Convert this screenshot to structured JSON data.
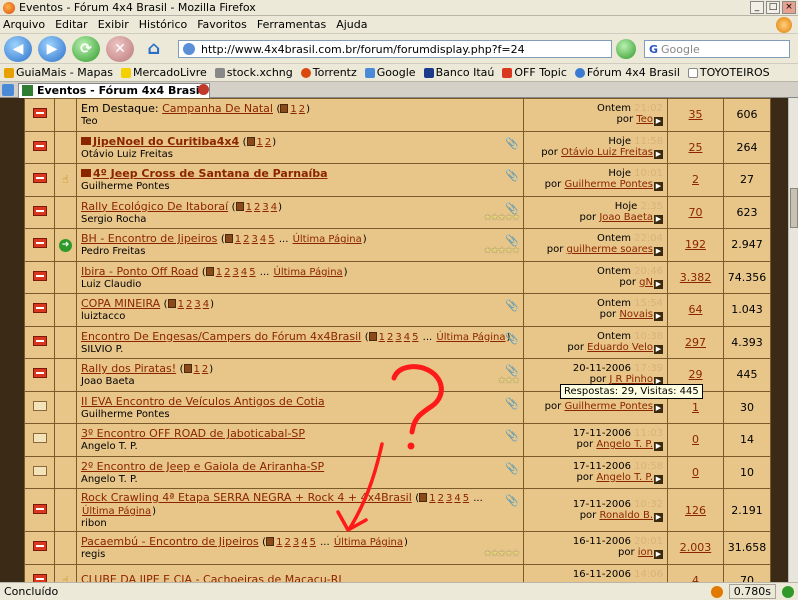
{
  "window": {
    "title": "Eventos - Fórum 4x4 Brasil - Mozilla Firefox",
    "min": "_",
    "max": "□",
    "close": "×"
  },
  "menu": [
    "Arquivo",
    "Editar",
    "Exibir",
    "Histórico",
    "Favoritos",
    "Ferramentas",
    "Ajuda"
  ],
  "nav": {
    "url": "http://www.4x4brasil.com.br/forum/forumdisplay.php?f=24",
    "search_placeholder": "Google",
    "search_brand": "G"
  },
  "bookmarks": [
    "GuiaMais - Mapas",
    "MercadoLivre",
    "stock.xchng",
    "Torrentz",
    "Google",
    "Banco Itaú",
    "OFF Topic",
    "Fórum 4x4 Brasil",
    "TOYOTEIROS"
  ],
  "tab": {
    "label": "Eventos - Fórum 4x4 Brasil"
  },
  "threads": [
    {
      "status": "hot",
      "icon": "",
      "prefix": "Em Destaque: ",
      "title": "Campanha De Natal",
      "bold": false,
      "sticky": false,
      "pages": [
        "1",
        "2"
      ],
      "last_page": "",
      "author": "Teo",
      "date": "Ontem",
      "time": "21:02",
      "by_label": "por",
      "by": "Teo",
      "replies": "35",
      "views": "606",
      "clip": "",
      "stars": ""
    },
    {
      "status": "hot-lock",
      "icon": "",
      "prefix": "",
      "title": "JipeNoel do Curitiba4x4",
      "bold": true,
      "sticky": true,
      "pages": [
        "1",
        "2"
      ],
      "last_page": "",
      "author": "Otávio Luiz Freitas",
      "date": "Hoje",
      "time": "11:58",
      "by_label": "por",
      "by": "Otávio Luiz Freitas",
      "replies": "25",
      "views": "264",
      "clip": "📎",
      "stars": ""
    },
    {
      "status": "hot-lock",
      "icon": "flag",
      "prefix": "",
      "title": "4º Jeep Cross de Santana de Parnaíba",
      "bold": true,
      "sticky": true,
      "pages": [],
      "last_page": "",
      "author": "Guilherme Pontes",
      "date": "Hoje",
      "time": "10:01",
      "by_label": "por",
      "by": "Guilherme Pontes",
      "replies": "2",
      "views": "27",
      "clip": "📎",
      "stars": ""
    },
    {
      "status": "hot",
      "icon": "",
      "prefix": "",
      "title": "Rally Ecológico De Itaboraí",
      "bold": false,
      "sticky": false,
      "pages": [
        "1",
        "2",
        "3",
        "4"
      ],
      "last_page": "",
      "author": "Sergio Rocha",
      "date": "Hoje",
      "time": "2:35",
      "by_label": "por",
      "by": "Joao Baeta",
      "replies": "70",
      "views": "623",
      "clip": "📎",
      "stars": "★★★★★"
    },
    {
      "status": "hot",
      "icon": "arrow",
      "prefix": "",
      "title": "BH - Encontro de Jipeiros",
      "bold": false,
      "sticky": false,
      "pages": [
        "1",
        "2",
        "3",
        "4",
        "5"
      ],
      "last_page": "Última Página",
      "author": "Pedro Freitas",
      "date": "Ontem",
      "time": "22:04",
      "by_label": "por",
      "by": "guilherme soares",
      "replies": "192",
      "views": "2.947",
      "clip": "📎",
      "stars": "★★★★★"
    },
    {
      "status": "hot",
      "icon": "",
      "prefix": "",
      "title": "Ibira - Ponto Off Road",
      "bold": false,
      "sticky": false,
      "pages": [
        "1",
        "2",
        "3",
        "4",
        "5"
      ],
      "last_page": "Última Página",
      "author": "Luiz Claudio",
      "date": "Ontem",
      "time": "20:46",
      "by_label": "por",
      "by": "gN",
      "replies": "3.382",
      "views": "74.356",
      "clip": "",
      "stars": ""
    },
    {
      "status": "hot",
      "icon": "",
      "prefix": "",
      "title": "COPA MINEIRA",
      "bold": false,
      "sticky": false,
      "pages": [
        "1",
        "2",
        "3",
        "4"
      ],
      "last_page": "",
      "author": "luiztacco",
      "date": "Ontem",
      "time": "15:54",
      "by_label": "por",
      "by": "Novais",
      "replies": "64",
      "views": "1.043",
      "clip": "📎",
      "stars": ""
    },
    {
      "status": "hot",
      "icon": "",
      "prefix": "",
      "title": "Encontro De Engesas/Campers do Fórum 4x4Brasil",
      "bold": false,
      "sticky": false,
      "pages": [
        "1",
        "2",
        "3",
        "4",
        "5"
      ],
      "last_page": "Última Página",
      "author": "SILVIO P.",
      "date": "Ontem",
      "time": "10:38",
      "by_label": "por",
      "by": "Eduardo Velo",
      "replies": "297",
      "views": "4.393",
      "clip": "📎",
      "stars": ""
    },
    {
      "status": "hot",
      "icon": "",
      "prefix": "",
      "title": "Rally dos Piratas!",
      "bold": false,
      "sticky": false,
      "pages": [
        "1",
        "2"
      ],
      "last_page": "",
      "author": "Joao Baeta",
      "date": "20-11-2006",
      "time": "17:39",
      "by_label": "por",
      "by": "J R Pinho",
      "replies": "29",
      "views": "445",
      "clip": "📎",
      "stars": "★★★"
    },
    {
      "status": "read",
      "icon": "",
      "prefix": "",
      "title": "II EVA Encontro de Veículos Antigos de Cotia",
      "bold": false,
      "sticky": false,
      "pages": [],
      "last_page": "",
      "author": "Guilherme Pontes",
      "date": "",
      "time": "",
      "by_label": "por",
      "by": "Guilherme Pontes",
      "replies": "1",
      "views": "30",
      "clip": "📎",
      "stars": ""
    },
    {
      "status": "read",
      "icon": "",
      "prefix": "",
      "title": "3º Encontro OFF ROAD de Jaboticabal-SP",
      "bold": false,
      "sticky": false,
      "pages": [],
      "last_page": "",
      "author": "Angelo T. P.",
      "date": "17-11-2006",
      "time": "11:03",
      "by_label": "por",
      "by": "Angelo T. P.",
      "replies": "0",
      "views": "14",
      "clip": "📎",
      "stars": ""
    },
    {
      "status": "read",
      "icon": "",
      "prefix": "",
      "title": "2º Encontro de Jeep e Gaiola de Ariranha-SP",
      "bold": false,
      "sticky": false,
      "pages": [],
      "last_page": "",
      "author": "Angelo T. P.",
      "date": "17-11-2006",
      "time": "10:58",
      "by_label": "por",
      "by": "Angelo T. P.",
      "replies": "0",
      "views": "10",
      "clip": "📎",
      "stars": ""
    },
    {
      "status": "hot",
      "icon": "",
      "prefix": "",
      "title": "Rock Crawling 4ª Etapa SERRA NEGRA + Rock 4 + 4x4Brasil",
      "bold": false,
      "sticky": false,
      "pages": [
        "1",
        "2",
        "3",
        "4",
        "5"
      ],
      "last_page": "Última Página",
      "author": "ribon",
      "date": "17-11-2006",
      "time": "10:32",
      "by_label": "por",
      "by": "Ronaldo B.",
      "replies": "126",
      "views": "2.191",
      "clip": "📎",
      "stars": ""
    },
    {
      "status": "hot",
      "icon": "",
      "prefix": "",
      "title": "Pacaembú - Encontro de Jipeiros",
      "bold": false,
      "sticky": false,
      "pages": [
        "1",
        "2",
        "3",
        "4",
        "5"
      ],
      "last_page": "Última Página",
      "author": "regis",
      "date": "16-11-2006",
      "time": "20:01",
      "by_label": "por",
      "by": "ion",
      "replies": "2.003",
      "views": "31.658",
      "clip": "",
      "stars": "★★★★★"
    },
    {
      "status": "hot",
      "icon": "flag",
      "prefix": "",
      "title": "CLUBE DA JIPE E CIA - Cachoeiras de Macacu-RJ",
      "bold": false,
      "sticky": false,
      "pages": [],
      "last_page": "",
      "author": "",
      "date": "16-11-2006",
      "time": "14:06",
      "by_label": "por",
      "by": "",
      "replies": "4",
      "views": "70",
      "clip": "",
      "stars": ""
    }
  ],
  "tooltip": "Respostas: 29, Visitas: 445",
  "annotation": {
    "text": "?",
    "color": "#ff1a1a"
  },
  "status": {
    "left": "Concluído",
    "timing": "0.780s"
  }
}
